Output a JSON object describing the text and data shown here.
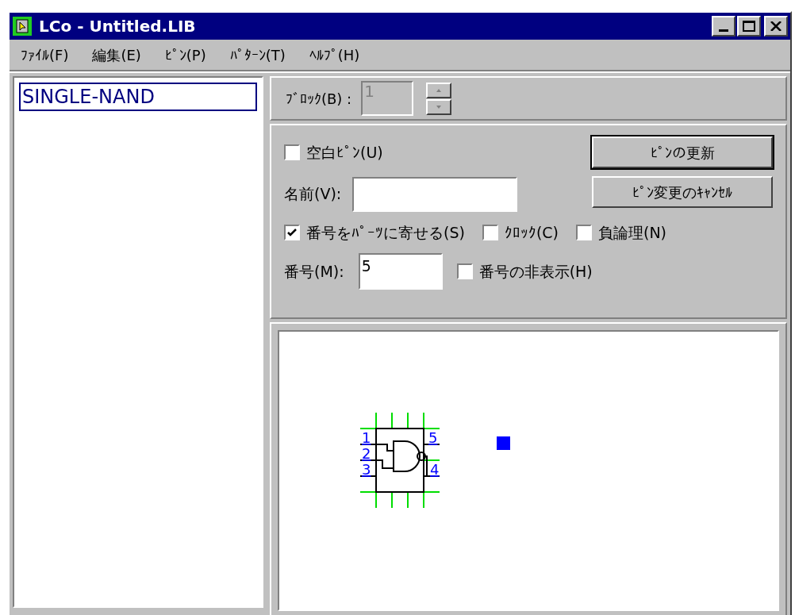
{
  "window": {
    "title": "LCo - Untitled.LIB"
  },
  "menu": [
    "ﾌｧｲﾙ(F)",
    "編集(E)",
    "ﾋﾟﾝ(P)",
    "ﾊﾟﾀｰﾝ(T)",
    "ﾍﾙﾌﾟ(H)"
  ],
  "parts_list": {
    "items": [
      {
        "label": "SINGLE-NAND",
        "selected": true
      }
    ]
  },
  "block": {
    "label": "ﾌﾞﾛｯｸ(B) :",
    "value": "1",
    "disabled": true
  },
  "blank_pin": {
    "label": "空白ﾋﾟﾝ(U)",
    "checked": false
  },
  "name": {
    "label": "名前(V):"
  },
  "buttons": [
    {
      "label": "ﾋﾟﾝの更新",
      "default": true
    },
    {
      "label": "ﾋﾟﾝ変更のｷｬﾝｾﾙ",
      "default": false
    }
  ],
  "options": [
    {
      "label": "番号をﾊﾟｰﾂに寄せる(S)",
      "checked": true
    },
    {
      "label": "ｸﾛｯｸ(C)",
      "checked": false
    },
    {
      "label": "負論理(N)",
      "checked": false
    }
  ],
  "number": {
    "label": "番号(M):",
    "value": "5"
  },
  "hide_number": {
    "label": "番号の非表示(H)",
    "checked": false
  },
  "preview": {
    "pins": [
      "1",
      "5",
      "2",
      "3",
      "4"
    ]
  }
}
